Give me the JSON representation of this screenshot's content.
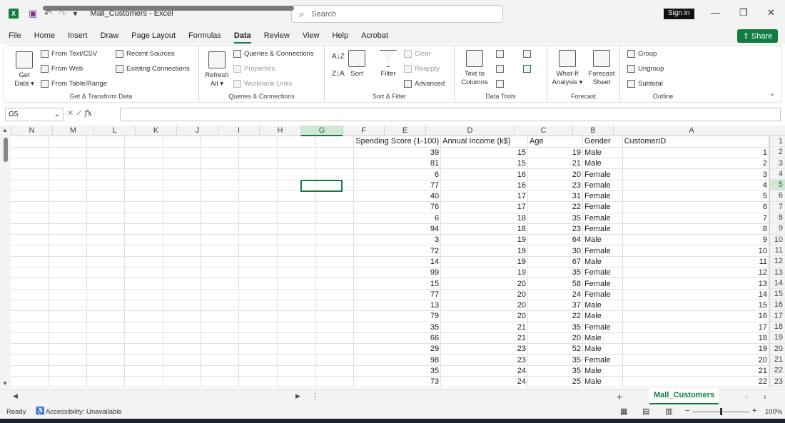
{
  "titlebar": {
    "logo": "X",
    "autosave": "▣",
    "undo": "↶",
    "redo": "↷",
    "customize": "▾",
    "title": "Mall_Customers  -  Excel",
    "search_placeholder": "Search",
    "signin": "Sign in",
    "minimize": "—",
    "restore": "❐",
    "close": "✕"
  },
  "menu": [
    "File",
    "Home",
    "Insert",
    "Draw",
    "Page Layout",
    "Formulas",
    "Data",
    "Review",
    "View",
    "Help",
    "Acrobat"
  ],
  "share": "Share",
  "ribbon": {
    "get_transform": {
      "get_data": "Get",
      "get_data2": "Data ▾",
      "from_text": "From Text/CSV",
      "from_web": "From Web",
      "from_table": "From Table/Range",
      "recent": "Recent Sources",
      "existing": "Existing Connections",
      "label": "Get & Transform Data"
    },
    "queries": {
      "refresh": "Refresh",
      "refresh2": "All ▾",
      "qc": "Queries & Connections",
      "properties": "Properties",
      "links": "Workbook Links",
      "label": "Queries & Connections"
    },
    "sort_filter": {
      "az": "A↓Z",
      "za": "Z↓A",
      "sort": "Sort",
      "filter": "Filter",
      "clear": "Clear",
      "reapply": "Reapply",
      "advanced": "Advanced",
      "label": "Sort & Filter"
    },
    "data_tools": {
      "ttc": "Text to",
      "ttc2": "Columns",
      "label": "Data Tools"
    },
    "forecast": {
      "whatif": "What-If",
      "whatif2": "Analysis ▾",
      "sheet": "Forecast",
      "sheet2": "Sheet",
      "label": "Forecast"
    },
    "outline": {
      "group": "Group",
      "ungroup": "Ungroup",
      "subtotal": "Subtotal",
      "label": "Outline"
    }
  },
  "formula": {
    "name_box": "G5",
    "fx": "fx",
    "value": ""
  },
  "columns": [
    "N",
    "M",
    "L",
    "K",
    "J",
    "I",
    "H",
    "G",
    "F",
    "E",
    "D",
    "C",
    "B",
    "A"
  ],
  "headers": {
    "E": "Spending Score (1-100)",
    "D": "Annual Income (k$)",
    "C": "Age",
    "B": "Gender",
    "A": "CustomerID"
  },
  "rows": [
    {
      "id": 1,
      "g": "Male",
      "age": 19,
      "inc": 15,
      "sp": 39
    },
    {
      "id": 2,
      "g": "Male",
      "age": 21,
      "inc": 15,
      "sp": 81
    },
    {
      "id": 3,
      "g": "Female",
      "age": 20,
      "inc": 16,
      "sp": 6
    },
    {
      "id": 4,
      "g": "Female",
      "age": 23,
      "inc": 16,
      "sp": 77
    },
    {
      "id": 5,
      "g": "Female",
      "age": 31,
      "inc": 17,
      "sp": 40
    },
    {
      "id": 6,
      "g": "Female",
      "age": 22,
      "inc": 17,
      "sp": 76
    },
    {
      "id": 7,
      "g": "Female",
      "age": 35,
      "inc": 18,
      "sp": 6
    },
    {
      "id": 8,
      "g": "Female",
      "age": 23,
      "inc": 18,
      "sp": 94
    },
    {
      "id": 9,
      "g": "Male",
      "age": 64,
      "inc": 19,
      "sp": 3
    },
    {
      "id": 10,
      "g": "Female",
      "age": 30,
      "inc": 19,
      "sp": 72
    },
    {
      "id": 11,
      "g": "Male",
      "age": 67,
      "inc": 19,
      "sp": 14
    },
    {
      "id": 12,
      "g": "Female",
      "age": 35,
      "inc": 19,
      "sp": 99
    },
    {
      "id": 13,
      "g": "Female",
      "age": 58,
      "inc": 20,
      "sp": 15
    },
    {
      "id": 14,
      "g": "Female",
      "age": 24,
      "inc": 20,
      "sp": 77
    },
    {
      "id": 15,
      "g": "Male",
      "age": 37,
      "inc": 20,
      "sp": 13
    },
    {
      "id": 16,
      "g": "Male",
      "age": 22,
      "inc": 20,
      "sp": 79
    },
    {
      "id": 17,
      "g": "Female",
      "age": 35,
      "inc": 21,
      "sp": 35
    },
    {
      "id": 18,
      "g": "Male",
      "age": 20,
      "inc": 21,
      "sp": 66
    },
    {
      "id": 19,
      "g": "Male",
      "age": 52,
      "inc": 23,
      "sp": 29
    },
    {
      "id": 20,
      "g": "Female",
      "age": 35,
      "inc": 23,
      "sp": 98
    },
    {
      "id": 21,
      "g": "Male",
      "age": 35,
      "inc": 24,
      "sp": 35
    },
    {
      "id": 22,
      "g": "Male",
      "age": 25,
      "inc": 24,
      "sp": 73
    }
  ],
  "row_numbers": [
    1,
    2,
    3,
    4,
    5,
    6,
    7,
    8,
    9,
    10,
    11,
    12,
    13,
    14,
    15,
    16,
    17,
    18,
    19,
    20,
    21,
    22,
    23
  ],
  "selected_row": 5,
  "sheet_tab": "Mall_Customers",
  "add_sheet": "+",
  "status": {
    "ready": "Ready",
    "accessibility": "Accessibility: Unavailable",
    "zoom": "100%"
  },
  "colors": {
    "accent": "#107c41",
    "selection_header": "#d2e6d8"
  }
}
